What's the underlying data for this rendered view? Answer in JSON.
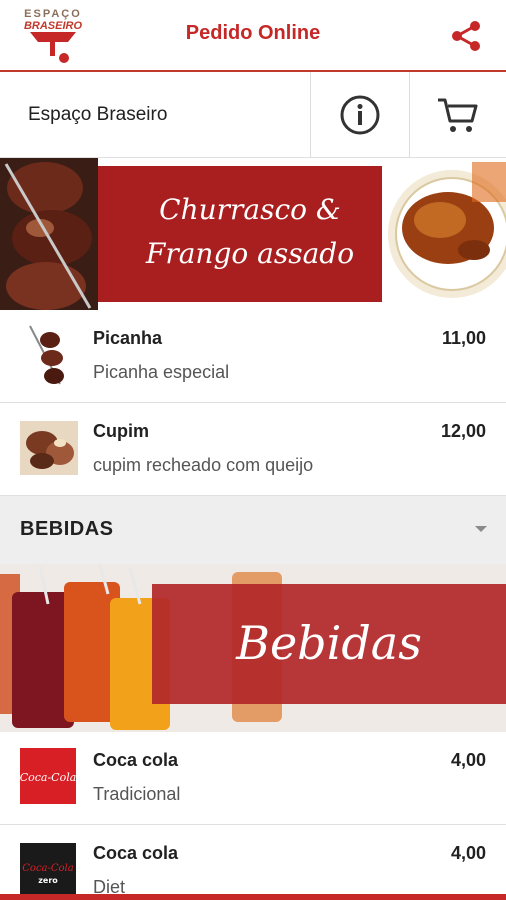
{
  "header": {
    "logo_line1": "ESPAÇO",
    "logo_line2": "BRASEIRO",
    "title": "Pedido Online",
    "share_icon": "share-icon"
  },
  "store": {
    "name": "Espaço Braseiro",
    "info_icon": "info-icon",
    "cart_icon": "cart-icon"
  },
  "banner": {
    "line1": "Churrasco &",
    "line2": "Frango assado"
  },
  "items": [
    {
      "name": "Picanha",
      "description": "Picanha especial",
      "price": "11,00"
    },
    {
      "name": "Cupim",
      "description": "cupim recheado com queijo",
      "price": "12,00"
    }
  ],
  "section": {
    "title": "BEBIDAS",
    "chevron_icon": "chevron-down-icon"
  },
  "drinks_banner": {
    "text": "Bebidas"
  },
  "drinks": [
    {
      "name": "Coca cola",
      "description": "Tradicional",
      "price": "4,00",
      "logo_text": "Coca-Cola"
    },
    {
      "name": "Coca cola",
      "description": "Diet",
      "price": "4,00",
      "logo_text": "Coca-Cola",
      "logo_subtext": "zero"
    }
  ],
  "colors": {
    "accent": "#c62828",
    "banner_red": "#a91e1e",
    "section_bg": "#eeeeee"
  }
}
